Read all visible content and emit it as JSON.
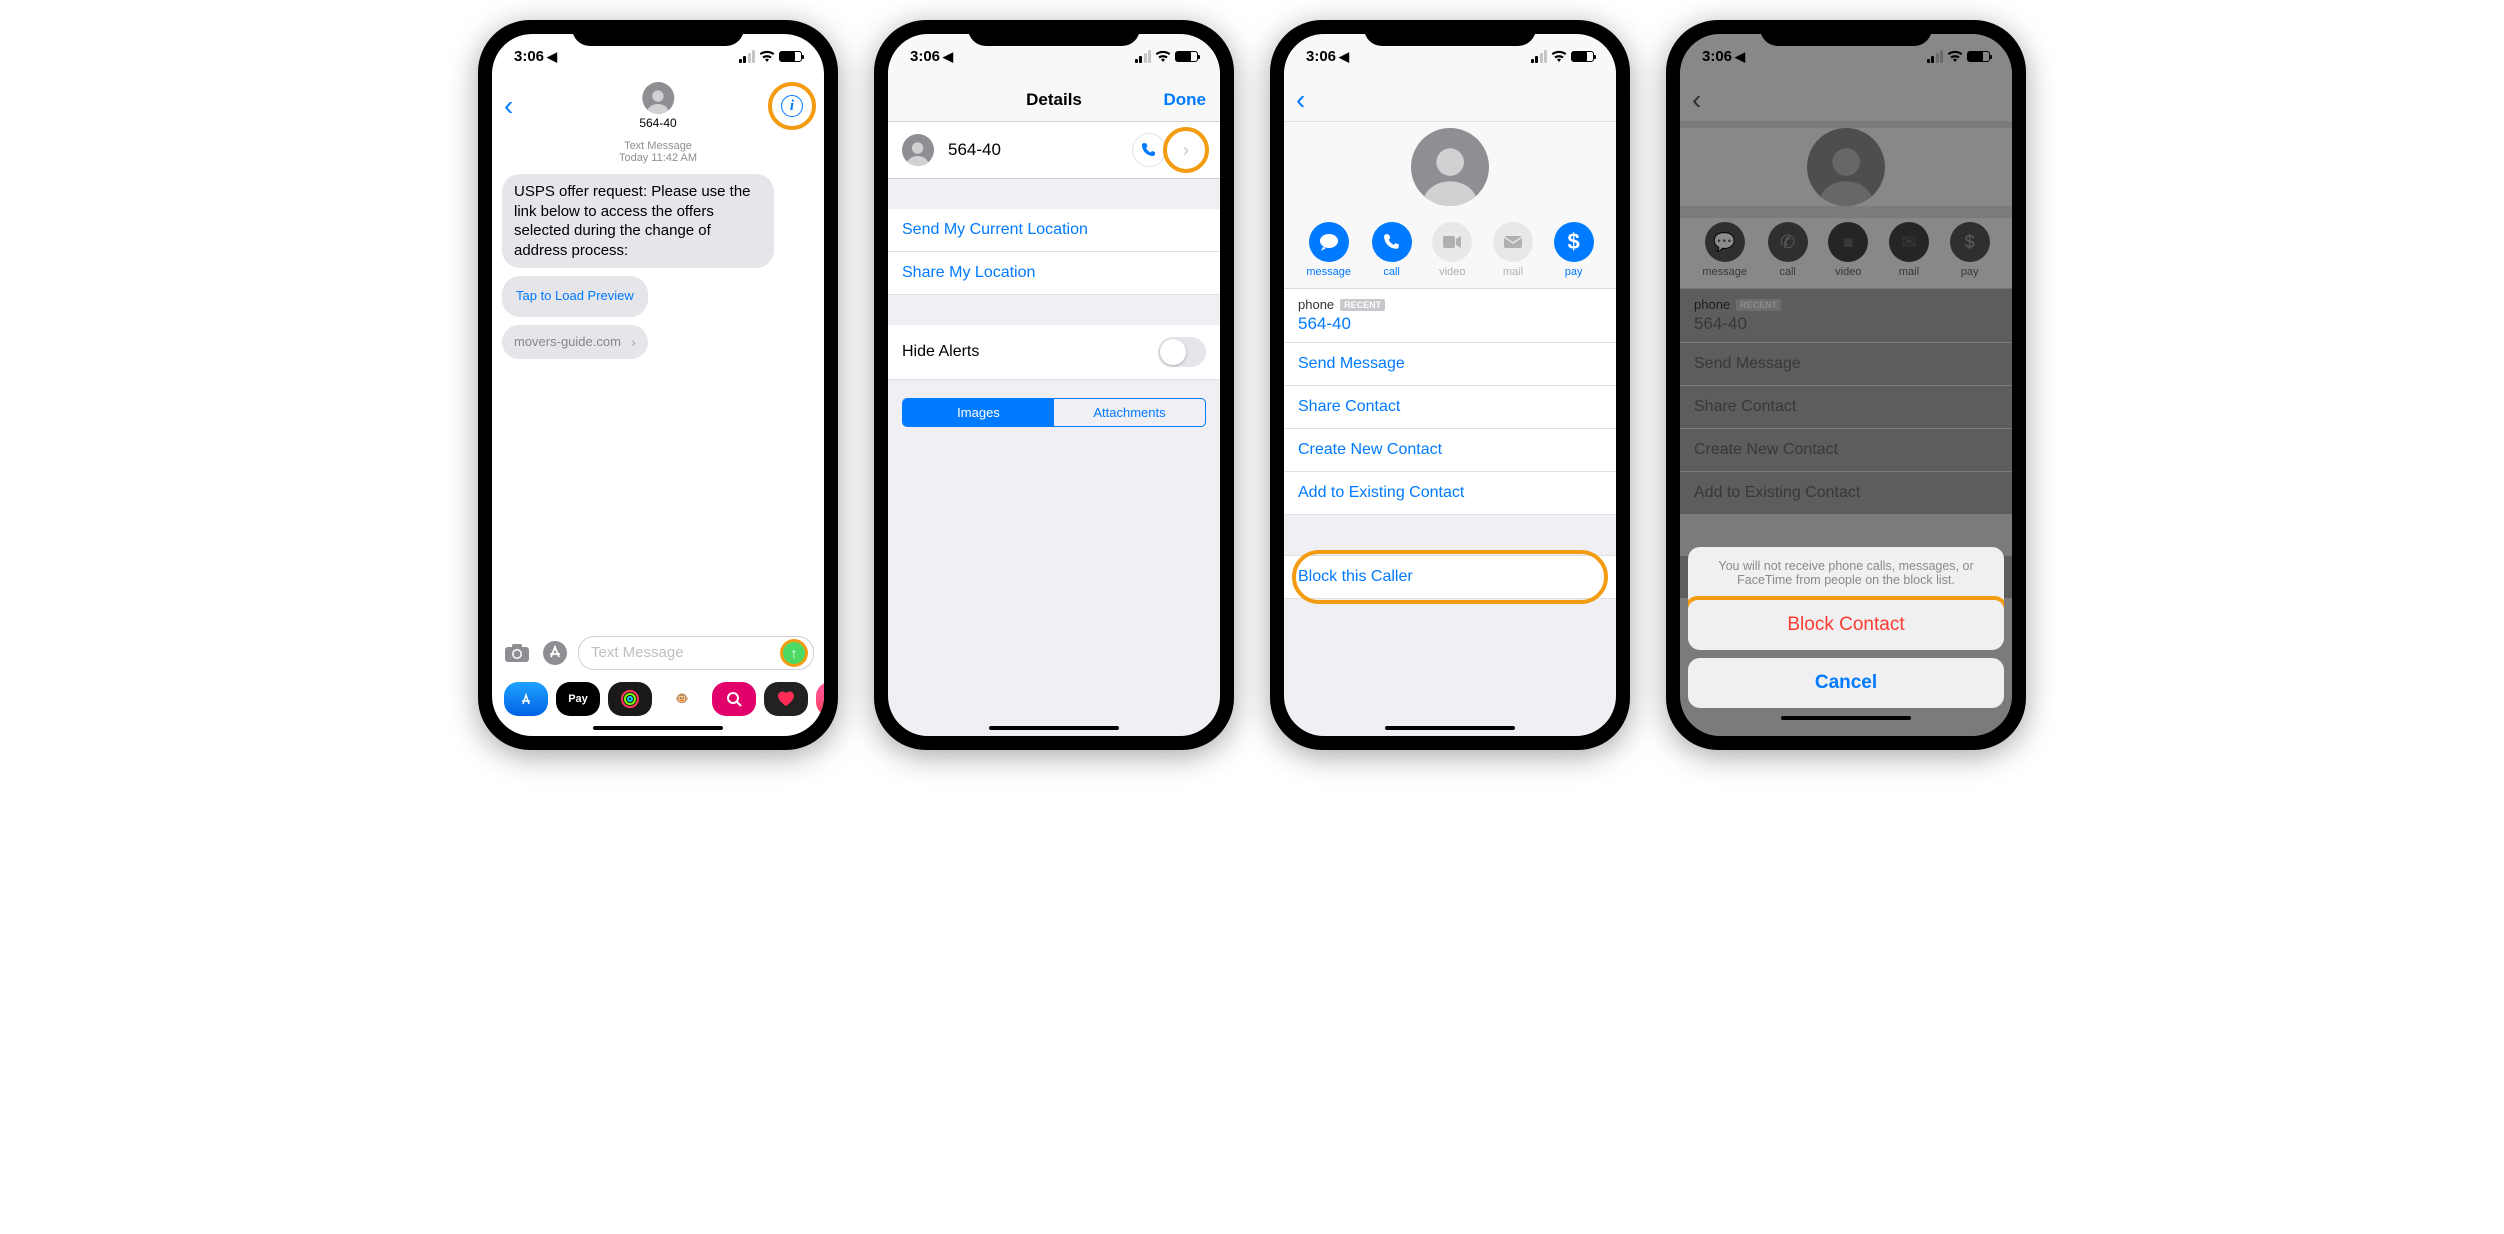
{
  "status": {
    "time": "3:06",
    "loc_arrow": "➤"
  },
  "s1": {
    "title_number": "564-40",
    "meta_type": "Text Message",
    "meta_day": "Today",
    "meta_time": "11:42 AM",
    "body": "USPS offer request: Please use the link below to access the offers selected during the change of address process:",
    "tap_preview": "Tap to Load Preview",
    "link_domain": "movers-guide.com",
    "placeholder": "Text Message",
    "tray_applepay": "Pay"
  },
  "s2": {
    "title": "Details",
    "done": "Done",
    "contact_number": "564-40",
    "send_loc": "Send My Current Location",
    "share_loc": "Share My Location",
    "hide_alerts": "Hide Alerts",
    "seg_images": "Images",
    "seg_attachments": "Attachments"
  },
  "s3": {
    "phone_label": "phone",
    "recent": "RECENT",
    "phone_number": "564-40",
    "act_message": "message",
    "act_call": "call",
    "act_video": "video",
    "act_mail": "mail",
    "act_pay": "pay",
    "send_message": "Send Message",
    "share_contact": "Share Contact",
    "create_contact": "Create New Contact",
    "add_existing": "Add to Existing Contact",
    "block_caller": "Block this Caller"
  },
  "s4": {
    "sheet_text": "You will not receive phone calls, messages, or FaceTime from people on the block list.",
    "block_contact": "Block Contact",
    "cancel": "Cancel"
  }
}
